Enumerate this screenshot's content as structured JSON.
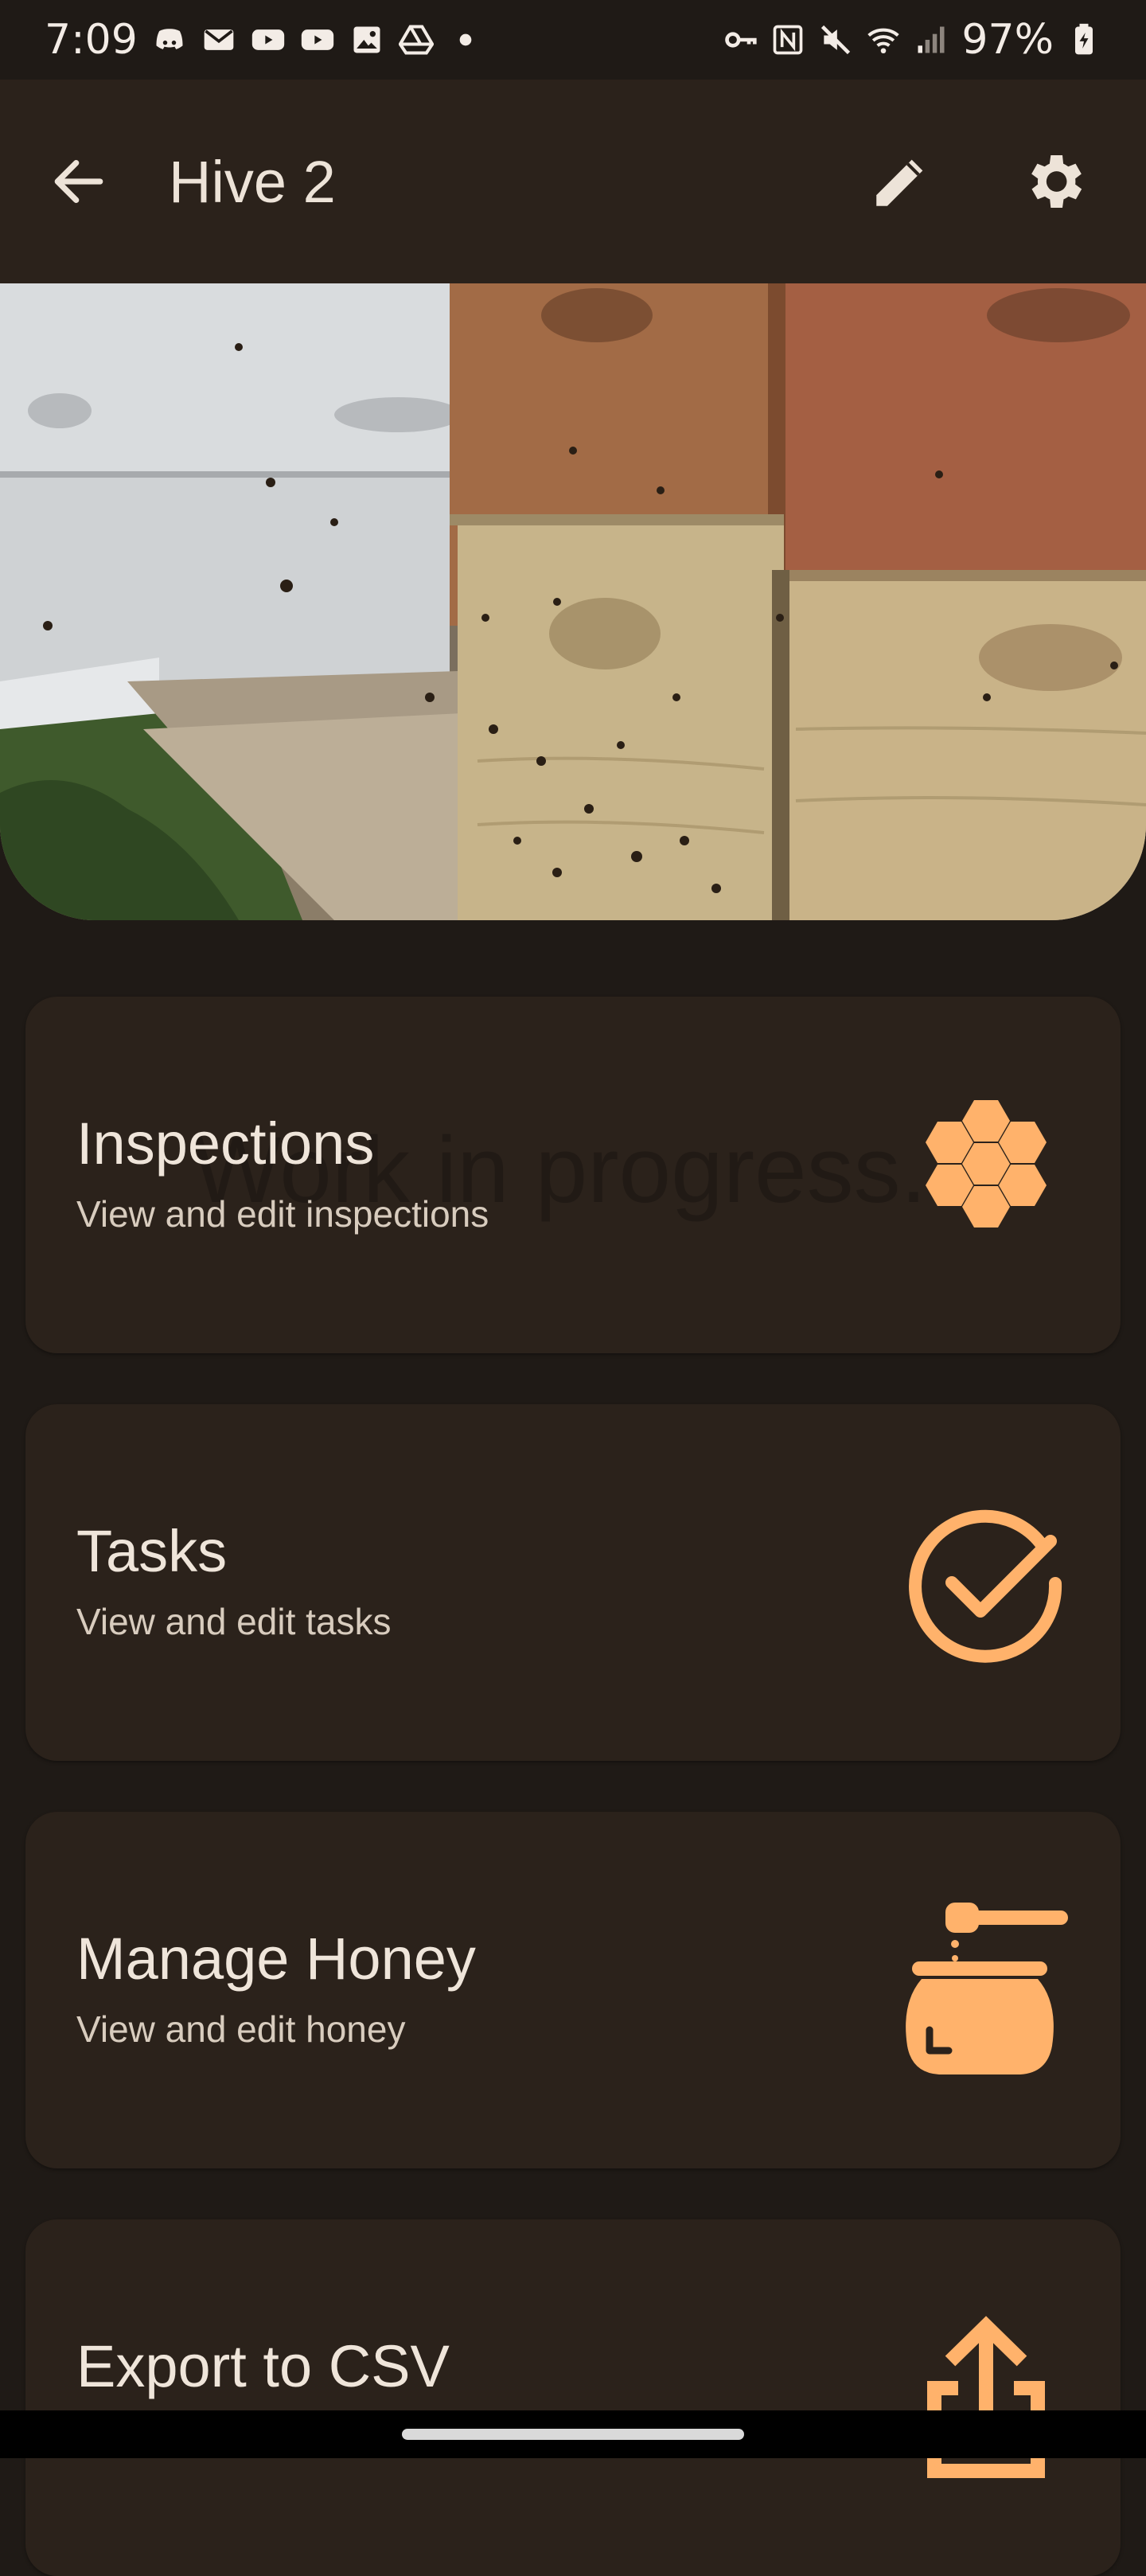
{
  "status_bar": {
    "time": "7:09",
    "battery": "97%",
    "notification_icons": [
      "discord-icon",
      "mail-icon",
      "youtube-icon",
      "youtube-icon",
      "photos-icon",
      "drive-icon",
      "dot-icon"
    ],
    "system_icons": [
      "vpn-key-icon",
      "nfc-icon",
      "mute-icon",
      "wifi-icon",
      "signal-icon",
      "battery-charging-icon"
    ]
  },
  "app_bar": {
    "title": "Hive 2",
    "back_icon": "arrow-back-icon",
    "edit_icon": "pencil-icon",
    "settings_icon": "gear-icon"
  },
  "hero": {
    "image": "beehive-photo"
  },
  "cards": [
    {
      "title": "Inspections",
      "subtitle": "View and edit inspections",
      "icon": "honeycomb-icon",
      "watermark": "Work in progress."
    },
    {
      "title": "Tasks",
      "subtitle": "View and edit tasks",
      "icon": "check-circle-icon"
    },
    {
      "title": "Manage Honey",
      "subtitle": "View and edit honey",
      "icon": "honey-jar-icon"
    },
    {
      "title": "Export to CSV",
      "subtitle": "",
      "icon": "share-export-icon"
    }
  ],
  "colors": {
    "accent": "#ffb26b",
    "background": "#1f1a16",
    "surface": "#2b221b",
    "on_surface": "#ece0d4"
  }
}
